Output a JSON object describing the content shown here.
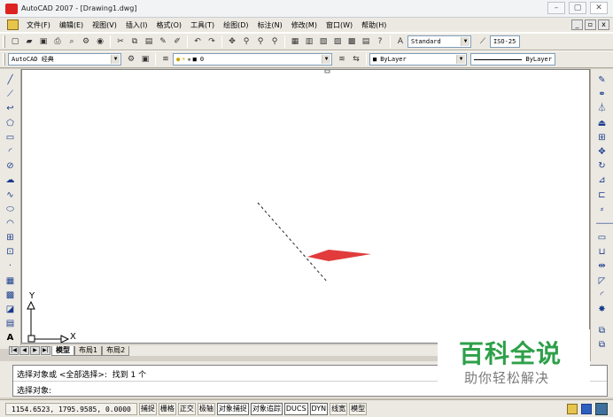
{
  "window": {
    "title": "AutoCAD 2007 - [Drawing1.dwg]",
    "controls": [
      "–",
      "▢",
      "✕"
    ]
  },
  "menu": {
    "items": [
      "文件(F)",
      "编辑(E)",
      "视图(V)",
      "插入(I)",
      "格式(O)",
      "工具(T)",
      "绘图(D)",
      "标注(N)",
      "修改(M)",
      "窗口(W)",
      "帮助(H)"
    ],
    "doc_controls": [
      "_",
      "▫",
      "x"
    ]
  },
  "toolbar1": {
    "text_style": "Standard",
    "dim_style": "ISO-25"
  },
  "toolbar2": {
    "workspace": "AutoCAD 经典",
    "layer": "0",
    "color": "ByLayer",
    "linetype": "ByLayer"
  },
  "canvas": {
    "ucs_x": "X",
    "ucs_y": "Y",
    "line_color": "#222222",
    "arrow_color": "#e23b3b"
  },
  "tabs": {
    "items": [
      "模型",
      "布局1",
      "布局2"
    ],
    "active": "模型"
  },
  "command": {
    "line1": "选择对象或 <全部选择>:  找到 1 个",
    "line2": "选择对象:"
  },
  "status": {
    "coords": "1154.6523, 1795.9585, 0.0000",
    "buttons": [
      "捕捉",
      "栅格",
      "正交",
      "极轴",
      "对象捕捉",
      "对象追踪",
      "DUCS",
      "DYN",
      "线宽",
      "模型"
    ]
  },
  "watermark": {
    "title": "百科全说",
    "subtitle": "助你轻松解决",
    "color": "#2ea049"
  }
}
